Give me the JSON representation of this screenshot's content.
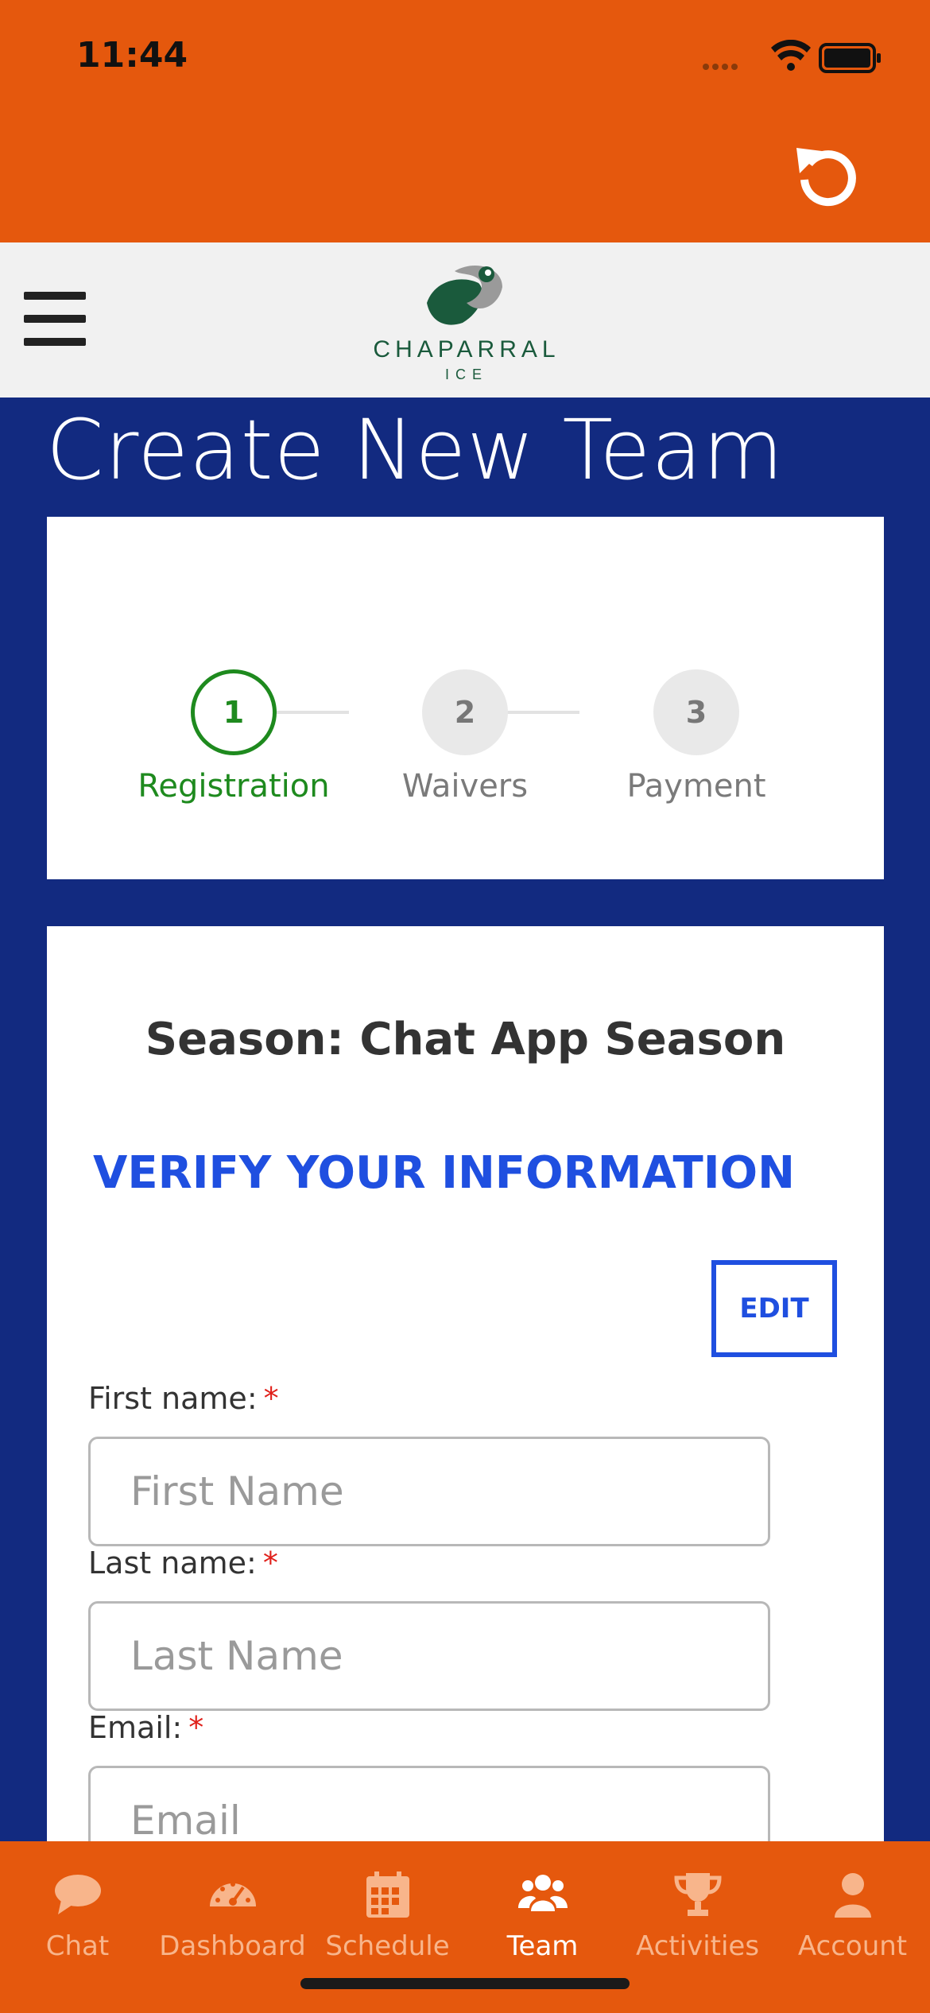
{
  "status_bar": {
    "time": "11:44"
  },
  "header": {
    "reload_icon": "reload-icon",
    "menu_icon": "hamburger-icon"
  },
  "logo": {
    "name": "CHAPARRAL",
    "sub": "ICE"
  },
  "page": {
    "title": "Create New Team"
  },
  "stepper": {
    "steps": [
      {
        "number": "1",
        "label": "Registration",
        "active": true
      },
      {
        "number": "2",
        "label": "Waivers",
        "active": false
      },
      {
        "number": "3",
        "label": "Payment",
        "active": false
      }
    ]
  },
  "form": {
    "season": "Season: Chat App Season",
    "heading": "VERIFY YOUR INFORMATION",
    "edit_label": "EDIT",
    "fields": [
      {
        "label": "First name:",
        "required": "*",
        "placeholder": "First Name"
      },
      {
        "label": "Last name:",
        "required": "*",
        "placeholder": "Last Name"
      },
      {
        "label": "Email:",
        "required": "*",
        "placeholder": "Email"
      }
    ]
  },
  "tabs": [
    {
      "label": "Chat",
      "icon": "chat-icon",
      "active": false
    },
    {
      "label": "Dashboard",
      "icon": "dashboard-icon",
      "active": false
    },
    {
      "label": "Schedule",
      "icon": "calendar-icon",
      "active": false
    },
    {
      "label": "Team",
      "icon": "team-icon",
      "active": true
    },
    {
      "label": "Activities",
      "icon": "trophy-icon",
      "active": false
    },
    {
      "label": "Account",
      "icon": "account-icon",
      "active": false
    }
  ],
  "colors": {
    "header_orange": "#e5580d",
    "page_blue": "#122a80",
    "accent_blue": "#1f4fe0",
    "active_green": "#1e8a1e",
    "required_red": "#e0201a"
  }
}
